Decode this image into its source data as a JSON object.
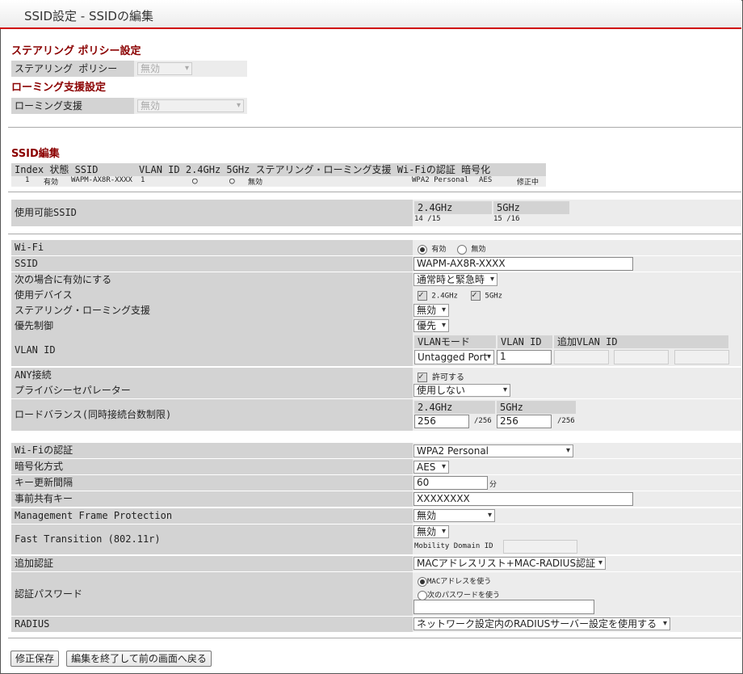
{
  "page": {
    "title": "SSID設定 - SSIDの編集"
  },
  "steering": {
    "section_title": "ステアリング ポリシー設定",
    "policy_label": "ステアリング ポリシー",
    "policy_value": "無効"
  },
  "roaming": {
    "section_title": "ローミング支援設定",
    "label": "ローミング支援",
    "value": "無効"
  },
  "ssid_edit": {
    "section_title": "SSID編集",
    "columns": [
      "Index",
      "状態",
      "SSID",
      "VLAN ID",
      "2.4GHz",
      "5GHz",
      "ステアリング・ローミング支援",
      "Wi-Fiの認証",
      "暗号化"
    ],
    "header_line": "Index 状態 SSID       VLAN ID 2.4GHz 5GHz ステアリング・ローミング支援 Wi-Fiの認証 暗号化",
    "row": {
      "index": "1",
      "status": "有効",
      "ssid": "WAPM-AX8R-XXXX",
      "vlan": "1",
      "g24": "○",
      "g5": "○",
      "steer": "無効",
      "auth": "WPA2 Personal",
      "enc": "AES",
      "state": "修正中"
    }
  },
  "available": {
    "label": "使用可能SSID",
    "col24": "2.4GHz",
    "col5": "5GHz",
    "val24": "14 /15",
    "val5": "15 /16"
  },
  "form": {
    "wifi": {
      "label": "Wi-Fi",
      "opt_on": "有効",
      "opt_off": "無効"
    },
    "ssid": {
      "label": "SSID",
      "value": "WAPM-AX8R-XXXX"
    },
    "enable_when": {
      "label": "次の場合に有効にする",
      "value": "通常時と緊急時"
    },
    "devices": {
      "label": "使用デバイス",
      "d24": "2.4GHz",
      "d5": "5GHz"
    },
    "steer_roam": {
      "label": "ステアリング・ローミング支援",
      "value": "無効"
    },
    "priority": {
      "label": "優先制御",
      "value": "優先"
    },
    "vlan": {
      "label": "VLAN ID",
      "mode_header": "VLANモード",
      "id_header": "VLAN ID",
      "add_header": "追加VLAN ID",
      "mode_value": "Untagged Port",
      "id_value": "1"
    },
    "any": {
      "label": "ANY接続",
      "value": "許可する"
    },
    "privacy": {
      "label": "プライバシーセパレーター",
      "value": "使用しない"
    },
    "load": {
      "label": "ロードバランス(同時接続台数制限)",
      "h24": "2.4GHz",
      "h5": "5GHz",
      "v24": "256",
      "v5": "256",
      "max24": "/256",
      "max5": "/256"
    },
    "auth": {
      "label": "Wi-Fiの認証",
      "value": "WPA2 Personal"
    },
    "enc": {
      "label": "暗号化方式",
      "value": "AES"
    },
    "rekey": {
      "label": "キー更新間隔",
      "value": "60",
      "unit": "分"
    },
    "psk": {
      "label": "事前共有キー",
      "value": "XXXXXXXX"
    },
    "mfp": {
      "label": "Management Frame Protection",
      "value": "無効"
    },
    "ft": {
      "label": "Fast Transition (802.11r)",
      "value": "無効",
      "mdid_label": "Mobility Domain ID"
    },
    "addauth": {
      "label": "追加認証",
      "value": "MACアドレスリスト+MAC-RADIUS認証"
    },
    "authpw": {
      "label": "認証パスワード",
      "opt_mac": "MACアドレスを使う",
      "opt_next": "次のパスワードを使う"
    },
    "radius": {
      "label": "RADIUS",
      "value": "ネットワーク設定内のRADIUSサーバー設定を使用する"
    }
  },
  "buttons": {
    "save": "修正保存",
    "exit": "編集を終了して前の画面へ戻る"
  }
}
